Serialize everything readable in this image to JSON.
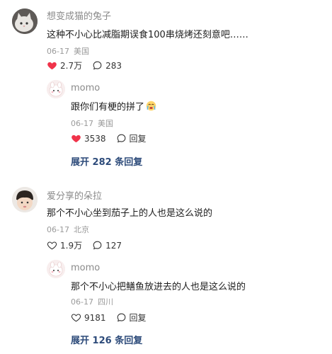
{
  "comments": [
    {
      "username": "想变成猫的兔子",
      "text": "这种不小心比减脂期误食100串烧烤还刻意吧……",
      "date": "06-17",
      "location": "美国",
      "likes": "2.7万",
      "liked": true,
      "replies_count": "283",
      "reply": {
        "username": "momo",
        "text": "跟你们有梗的拼了",
        "emoji": "crying-face-emoji",
        "date": "06-17",
        "location": "美国",
        "likes": "3538",
        "liked": true,
        "reply_label": "回复"
      },
      "expand_label": "展开 282 条回复"
    },
    {
      "username": "爱分享的朵拉",
      "text": "那个不小心坐到茄子上的人也是这么说的",
      "date": "06-17",
      "location": "北京",
      "likes": "1.9万",
      "liked": false,
      "replies_count": "127",
      "reply": {
        "username": "momo",
        "text": "那个不小心把鳝鱼放进去的人也是这么说的",
        "date": "06-17",
        "location": "四川",
        "likes": "9181",
        "liked": false,
        "reply_label": "回复"
      },
      "expand_label": "展开 126 条回复"
    }
  ],
  "colors": {
    "heart_red": "#f0334a",
    "expand_blue": "#2d4b7a",
    "meta_gray": "#9a9a9a"
  }
}
